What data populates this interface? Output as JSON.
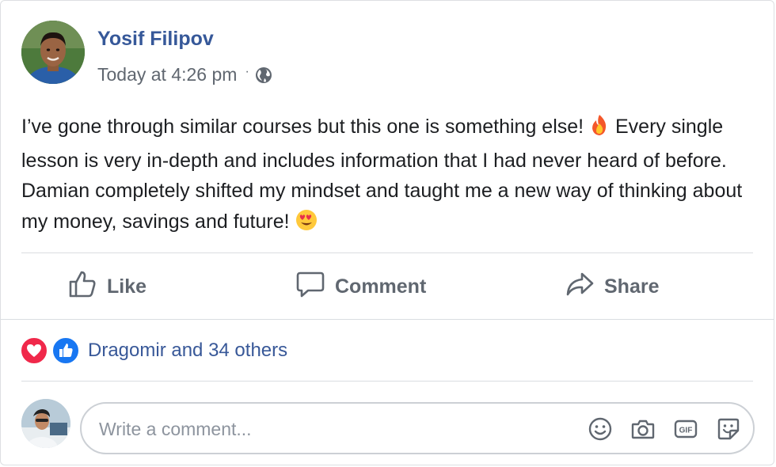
{
  "post": {
    "author_name": "Yosif Filipov",
    "timestamp": "Today at 4:26 pm",
    "meta_separator": "·",
    "privacy_icon": "globe-icon",
    "text_part1": "I’ve gone through similar courses but this one is something else! ",
    "emoji1": "fire-emoji",
    "text_part2": " Every single lesson is very in-depth and includes information that I had never heard of before. Damian completely shifted my mindset and taught me a new way of thinking about my money, savings and future! ",
    "emoji2": "heart-eyes-emoji"
  },
  "actions": {
    "like_label": "Like",
    "comment_label": "Comment",
    "share_label": "Share"
  },
  "reactions": {
    "icons": [
      "love-reaction-icon",
      "like-reaction-icon"
    ],
    "summary": "Dragomir and 34 others"
  },
  "comment_box": {
    "placeholder": "Write a comment...",
    "tools": [
      "emoji-icon",
      "camera-icon",
      "gif-icon",
      "sticker-icon"
    ]
  },
  "colors": {
    "author_link": "#365899",
    "reactor_link": "#385898",
    "muted_text": "#606770",
    "love": "#f0284a",
    "like": "#1877f2"
  }
}
